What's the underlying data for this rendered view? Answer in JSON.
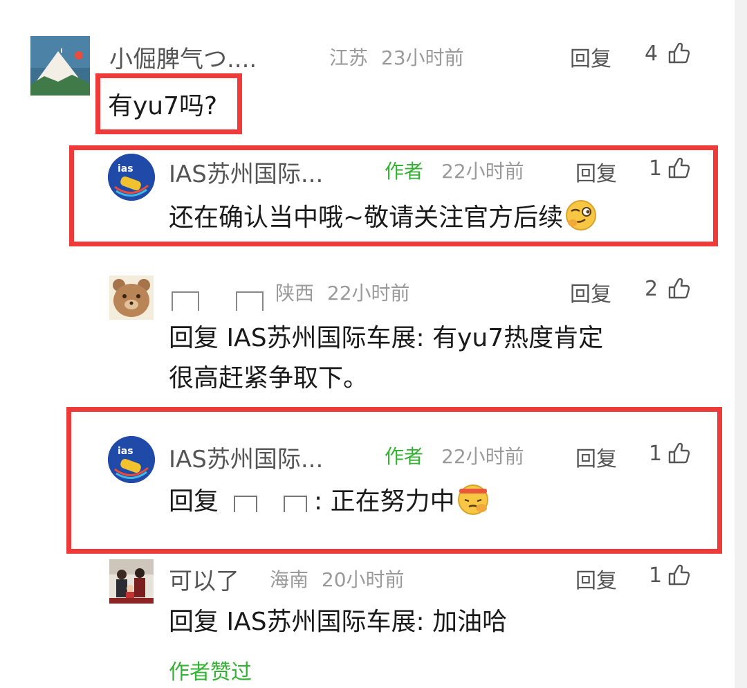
{
  "comments": [
    {
      "username": "小倔脾气つ....",
      "location": "江苏",
      "time": "23小时前",
      "reply_label": "回复",
      "likes": "4",
      "text": "有yu7吗?"
    },
    {
      "username": "IAS苏州国际...",
      "author_tag": "作者",
      "time": "22小时前",
      "reply_label": "回复",
      "likes": "1",
      "text": "还在确认当中哦~敬请关注官方后续",
      "avatar_text": "ias"
    },
    {
      "location": "陕西",
      "time": "22小时前",
      "reply_label": "回复",
      "likes": "2",
      "text_line1": "回复 IAS苏州国际车展: 有yu7热度肯定",
      "text_line2": "很高赶紧争取下。"
    },
    {
      "username": "IAS苏州国际...",
      "author_tag": "作者",
      "time": "22小时前",
      "reply_label": "回复",
      "likes": "1",
      "text_prefix": "回复",
      "text_suffix": ": 正在努力中",
      "avatar_text": "ias"
    },
    {
      "username": "可以了",
      "location": "海南",
      "time": "20小时前",
      "reply_label": "回复",
      "likes": "1",
      "text": "回复 IAS苏州国际车展: 加油哈",
      "liked_by_author": "作者赞过"
    }
  ],
  "colors": {
    "highlight": "#ef3a3a",
    "author_green": "#34b233",
    "meta_gray": "#9a9a9a"
  }
}
